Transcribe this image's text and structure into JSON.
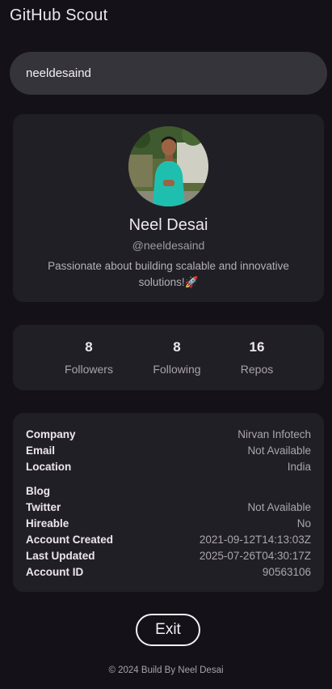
{
  "app": {
    "title": "GitHub Scout"
  },
  "search": {
    "value": "neeldesaind"
  },
  "profile": {
    "name": "Neel Desai",
    "handle": "@neeldesaind",
    "bio": "Passionate about building scalable and innovative solutions!🚀"
  },
  "stats": [
    {
      "value": "8",
      "label": "Followers"
    },
    {
      "value": "8",
      "label": "Following"
    },
    {
      "value": "16",
      "label": "Repos"
    }
  ],
  "details": [
    {
      "label": "Company",
      "value": "Nirvan Infotech"
    },
    {
      "label": "Email",
      "value": "Not Available"
    },
    {
      "label": "Location",
      "value": "India"
    },
    {
      "label": "Blog",
      "value": ""
    },
    {
      "label": "Twitter",
      "value": "Not Available"
    },
    {
      "label": "Hireable",
      "value": "No"
    },
    {
      "label": "Account Created",
      "value": "2021-09-12T14:13:03Z"
    },
    {
      "label": "Last Updated",
      "value": "2025-07-26T04:30:17Z"
    },
    {
      "label": "Account ID",
      "value": "90563106"
    }
  ],
  "actions": {
    "exit_label": "Exit"
  },
  "footer": {
    "text": "© 2024 Build By Neel Desai"
  }
}
